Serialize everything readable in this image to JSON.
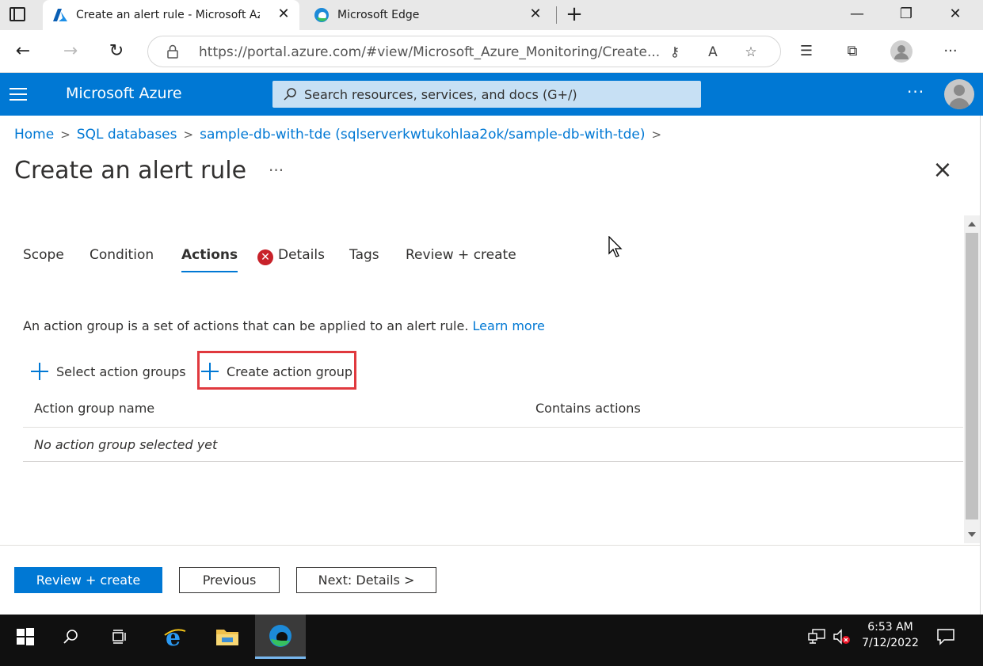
{
  "browser": {
    "tabs": [
      {
        "title": "Create an alert rule - Microsoft Azure",
        "active": true
      },
      {
        "title": "Microsoft Edge",
        "active": false
      }
    ],
    "url_host": "https://portal.azure.com",
    "url_path": "/#view/Microsoft_Azure_Monitoring/Create...",
    "window_controls": {
      "minimize": "—",
      "restore": "❐",
      "close": "✕"
    }
  },
  "azure": {
    "brand": "Microsoft Azure",
    "search_placeholder": "Search resources, services, and docs (G+/)",
    "more": "···"
  },
  "breadcrumb": [
    "Home",
    "SQL databases",
    "sample-db-with-tde (sqlserverkwtukohlaa2ok/sample-db-with-tde)"
  ],
  "page": {
    "title": "Create an alert rule",
    "more": "···"
  },
  "tabs": [
    {
      "label": "Scope"
    },
    {
      "label": "Condition"
    },
    {
      "label": "Actions",
      "selected": true
    },
    {
      "label": "Details",
      "error": true
    },
    {
      "label": "Tags"
    },
    {
      "label": "Review + create"
    }
  ],
  "actions": {
    "description": "An action group is a set of actions that can be applied to an alert rule.",
    "learn_more": "Learn more",
    "select_groups": "Select action groups",
    "create_group": "Create action group",
    "columns": [
      "Action group name",
      "Contains actions"
    ],
    "empty_message": "No action group selected yet"
  },
  "footer": {
    "review_create": "Review + create",
    "previous": "Previous",
    "next": "Next: Details >"
  },
  "taskbar": {
    "time": "6:53 AM",
    "date": "7/12/2022"
  },
  "colors": {
    "azure_blue": "#0078d4",
    "highlight_red": "#e0393e",
    "error_red": "#c8222a"
  }
}
